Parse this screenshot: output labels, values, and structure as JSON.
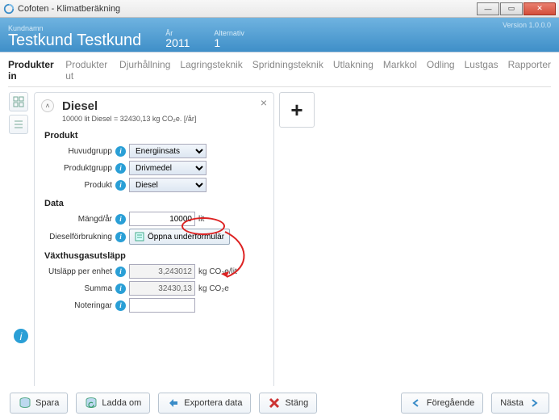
{
  "window": {
    "title": "Cofoten - Klimatberäkning"
  },
  "header": {
    "kundnamn_label": "Kundnamn",
    "kundnamn": "Testkund Testkund",
    "ar_label": "År",
    "ar": "2011",
    "alt_label": "Alternativ",
    "alt": "1",
    "version": "Version 1.0.0.0"
  },
  "tabs": [
    "Produkter in",
    "Produkter ut",
    "Djurhållning",
    "Lagringsteknik",
    "Spridningsteknik",
    "Utlakning",
    "Markkol",
    "Odling",
    "Lustgas",
    "Rapporter"
  ],
  "active_tab": 0,
  "panel": {
    "title": "Diesel",
    "summary": "10000 lit Diesel = 32430,13 kg CO₂e. [/år]",
    "sections": {
      "produkt": {
        "heading": "Produkt",
        "huvudgrupp_label": "Huvudgrupp",
        "huvudgrupp": "Energiinsats",
        "produktgrupp_label": "Produktgrupp",
        "produktgrupp": "Drivmedel",
        "produkt_label": "Produkt",
        "produkt": "Diesel"
      },
      "data": {
        "heading": "Data",
        "mangd_label": "Mängd/år",
        "mangd_value": "10000",
        "mangd_unit": "lit",
        "diesel_label": "Dieselförbrukning",
        "subform_btn": "Öppna underformulär"
      },
      "utslapp": {
        "heading": "Växthusgasutsläpp",
        "per_enhet_label": "Utsläpp per enhet",
        "per_enhet_value": "3,243012",
        "per_enhet_unit": "kg CO₂e/lit",
        "summa_label": "Summa",
        "summa_value": "32430,13",
        "summa_unit": "kg CO₂e",
        "noteringar_label": "Noteringar",
        "noteringar_value": ""
      }
    }
  },
  "buttons": {
    "spara": "Spara",
    "ladda": "Ladda om",
    "export": "Exportera data",
    "stang": "Stäng",
    "foregaende": "Föregående",
    "nasta": "Nästa"
  }
}
